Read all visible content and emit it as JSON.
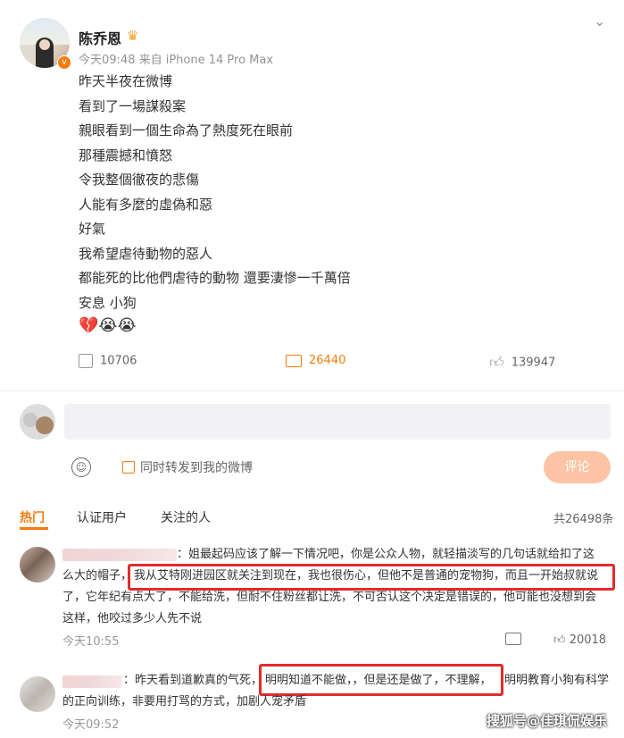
{
  "post": {
    "username": "陈乔恩",
    "crown_icon": "crown-icon",
    "verify_badge": "v",
    "meta": "今天09:48  来自 iPhone 14 Pro Max",
    "lines": [
      "昨天半夜在微博",
      "看到了一場謀殺案",
      "親眼看到一個生命為了熱度死在眼前",
      "那種震撼和憤怒",
      "令我整個徹夜的悲傷",
      "人能有多麼的虛偽和惡",
      "好氣",
      "我希望虐待動物的惡人",
      "都能死的比他們虐待的動物 還要淒慘一千萬倍",
      "安息 小狗"
    ],
    "emojis": "💔😭😭",
    "reposts": "10706",
    "comments": "26440",
    "likes": "139947"
  },
  "composer": {
    "placeholder": "",
    "repost_label": "同时转发到我的微博",
    "submit_label": "评论"
  },
  "tabs": {
    "items": [
      "热门",
      "认证用户",
      "关注的人"
    ],
    "total": "共26498条"
  },
  "comments": [
    {
      "line1": "：姐最起码应该了解一下情况吧，你是公众人物，就轻描淡写的几句话就给扣了这",
      "line2_pre": "么大的帽子，",
      "line2_hl": "我从艾特刚进园区就关注到现在，我也很伤心，但他不是普通的宠物狗，而且一开始叔就说",
      "line3": "了，它年纪有点大了，不能给洗，但耐不住粉丝都让洗，不可否认这个决定是错误的，他可能也没想到会",
      "line4": "这样，他咬过多少人先不说",
      "time": "今天10:55",
      "likes": "20018"
    },
    {
      "line1_pre": "：昨天看到道歉真的气死，",
      "line1_hl": "明明知道不能做，，但是还是做了，不理解，",
      "line1_post": "明明教育小狗有科学",
      "line2": "的正向训练，非要用打骂的方式，加剧人宠矛盾",
      "time": "今天09:52"
    }
  ],
  "watermark": "搜狐号@佳琪侃娱乐",
  "colors": {
    "accent": "#f77b0d",
    "highlight": "#e12c2c"
  }
}
